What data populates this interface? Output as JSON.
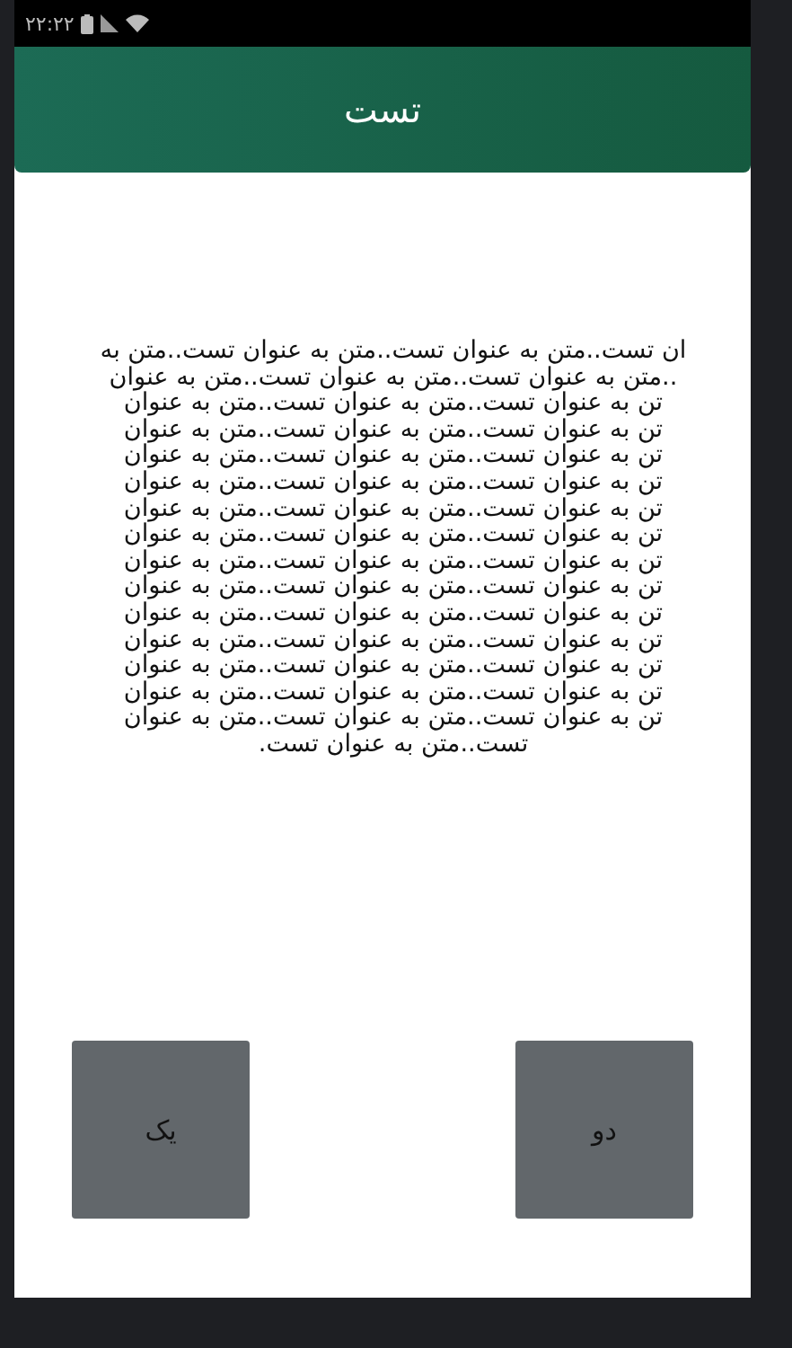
{
  "status_bar": {
    "time": "۲۲:۲۲"
  },
  "header": {
    "title": "تست"
  },
  "body": {
    "text": "ان تست..متن به عنوان تست..متن به عنوان تست..متن به\n..متن به عنوان تست..متن به عنوان تست..متن به عنوان\nتن به عنوان تست..متن به عنوان تست..متن به عنوان\nتن به عنوان تست..متن به عنوان تست..متن به عنوان\nتن به عنوان تست..متن به عنوان تست..متن به عنوان\nتن به عنوان تست..متن به عنوان تست..متن به عنوان\nتن به عنوان تست..متن به عنوان تست..متن به عنوان\nتن به عنوان تست..متن به عنوان تست..متن به عنوان\nتن به عنوان تست..متن به عنوان تست..متن به عنوان\nتن به عنوان تست..متن به عنوان تست..متن به عنوان\nتن به عنوان تست..متن به عنوان تست..متن به عنوان\nتن به عنوان تست..متن به عنوان تست..متن به عنوان\nتن به عنوان تست..متن به عنوان تست..متن به عنوان\nتن به عنوان تست..متن به عنوان تست..متن به عنوان\nتن به عنوان تست..متن به عنوان تست..متن به عنوان\nتست..متن به عنوان تست."
  },
  "buttons": [
    {
      "label": "دو"
    },
    {
      "label": "یک"
    }
  ]
}
